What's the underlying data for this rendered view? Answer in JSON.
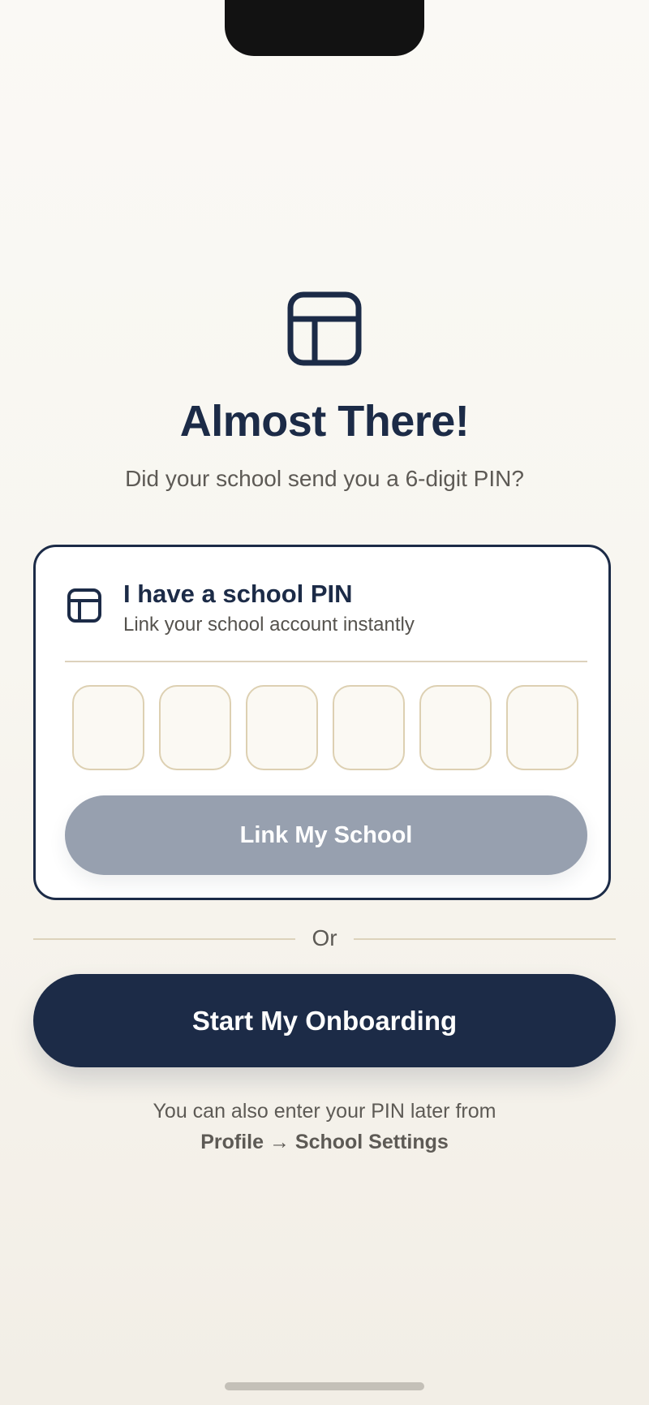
{
  "hero": {
    "icon": "layout-panel-icon",
    "title": "Almost There!",
    "subtitle": "Did your school send you a 6-digit PIN?"
  },
  "pin_card": {
    "icon": "layout-panel-icon",
    "title": "I have a school PIN",
    "subtitle": "Link your school account instantly",
    "pin_digits": [
      "",
      "",
      "",
      "",
      "",
      ""
    ],
    "link_button_label": "Link My School"
  },
  "divider": {
    "label": "Or"
  },
  "onboarding": {
    "button_label": "Start My Onboarding"
  },
  "footer": {
    "note": "You can also enter your PIN later from",
    "path": "Profile → School Settings"
  },
  "colors": {
    "primary": "#1c2b47",
    "disabled_button": "#97a0af",
    "pin_border": "#ddd0b2",
    "background": "#faf9f5"
  }
}
